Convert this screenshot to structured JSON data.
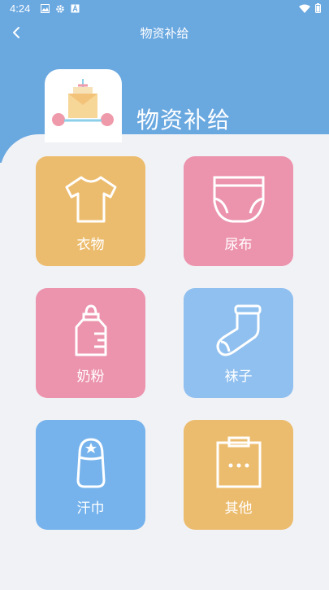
{
  "status_bar": {
    "time": "4:24"
  },
  "app_bar": {
    "title": "物资补给"
  },
  "hero": {
    "title": "物资补给"
  },
  "tiles": [
    {
      "label": "衣物",
      "icon": "shirt-icon",
      "color": "#ecbc6e"
    },
    {
      "label": "尿布",
      "icon": "diaper-icon",
      "color": "#ec93ad"
    },
    {
      "label": "奶粉",
      "icon": "baby-bottle-icon",
      "color": "#ec93ad"
    },
    {
      "label": "袜子",
      "icon": "sock-icon",
      "color": "#90c0ef"
    },
    {
      "label": "汗巾",
      "icon": "sweat-towel-icon",
      "color": "#76b3ec"
    },
    {
      "label": "其他",
      "icon": "more-box-icon",
      "color": "#ecbc6e"
    }
  ],
  "colors": {
    "header": "#6aa8e0",
    "background": "#f1f2f6"
  }
}
